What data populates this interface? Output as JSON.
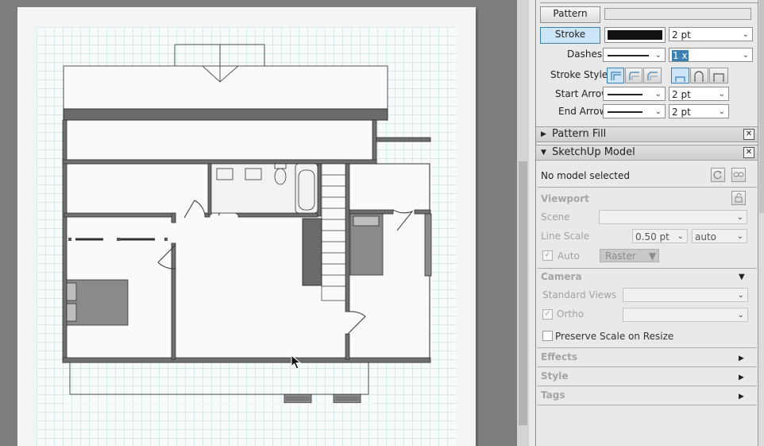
{
  "fill": {
    "pattern_button": "Pattern"
  },
  "stroke": {
    "stroke_button": "Stroke",
    "weight": "2 pt",
    "dashes_label": "Dashes:",
    "dash_scale": "1 x",
    "stroke_style_label": "Stroke Style:",
    "start_arrow_label": "Start Arrow:",
    "start_arrow_weight": "2 pt",
    "end_arrow_label": "End Arrow:",
    "end_arrow_weight": "2 pt",
    "color": "#111111"
  },
  "pattern_fill": {
    "title": "Pattern Fill"
  },
  "sketchup_model": {
    "title": "SketchUp Model",
    "status": "No model selected",
    "viewport": {
      "heading": "Viewport",
      "scene_label": "Scene",
      "line_scale_label": "Line Scale",
      "line_scale_value": "0.50 pt",
      "line_scale_mode": "auto",
      "auto_label": "Auto",
      "render_mode": "Raster"
    },
    "camera": {
      "heading": "Camera",
      "standard_views_label": "Standard Views",
      "ortho_label": "Ortho",
      "preserve_scale_label": "Preserve Scale on Resize"
    },
    "effects_heading": "Effects",
    "style_heading": "Style",
    "tags_heading": "Tags"
  },
  "icons": [
    "cursor-arrow-icon",
    "refresh-icon",
    "unlink-icon",
    "unlock-icon",
    "close-icon",
    "triangle-right-icon",
    "triangle-down-icon",
    "chevron-down-icon",
    "checkmark-icon"
  ],
  "colors": {
    "accent": "#3c7fb1",
    "panel": "#e9e9e9",
    "canvas": "#7d7d7d",
    "wall": "#555555"
  }
}
